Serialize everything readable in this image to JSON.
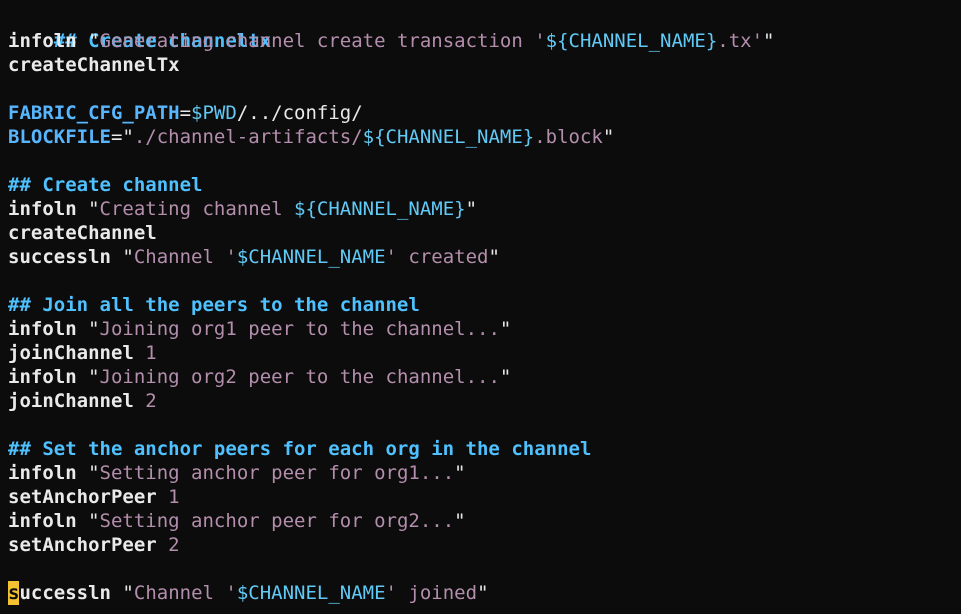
{
  "lines": {
    "l1": {
      "comment": "## Create channeltx"
    },
    "l2": {
      "cmd": "infoln",
      "q1": "\"",
      "text": "Generating channel create transaction '",
      "var": "${CHANNEL_NAME}",
      "text2": ".tx'",
      "q2": "\""
    },
    "l3": {
      "cmd": "createChannelTx"
    },
    "l5": {
      "key": "FABRIC_CFG_PATH",
      "eq": "=",
      "var": "$PWD",
      "rest": "/../config/"
    },
    "l6": {
      "key": "BLOCKFILE",
      "eq": "=",
      "q1": "\"",
      "text": "./channel-artifacts/",
      "var": "${CHANNEL_NAME}",
      "text2": ".block",
      "q2": "\""
    },
    "l8": {
      "comment": "## Create channel"
    },
    "l9": {
      "cmd": "infoln",
      "q1": "\"",
      "text": "Creating channel ",
      "var": "${CHANNEL_NAME}",
      "q2": "\""
    },
    "l10": {
      "cmd": "createChannel"
    },
    "l11": {
      "cmd": "successln",
      "q1": "\"",
      "text": "Channel '",
      "var": "$CHANNEL_NAME",
      "text2": "' created",
      "q2": "\""
    },
    "l13": {
      "comment": "## Join all the peers to the channel"
    },
    "l14": {
      "cmd": "infoln",
      "q1": "\"",
      "text": "Joining org1 peer to the channel...",
      "q2": "\""
    },
    "l15": {
      "cmd": "joinChannel",
      "arg": "1"
    },
    "l16": {
      "cmd": "infoln",
      "q1": "\"",
      "text": "Joining org2 peer to the channel...",
      "q2": "\""
    },
    "l17": {
      "cmd": "joinChannel",
      "arg": "2"
    },
    "l19": {
      "comment": "## Set the anchor peers for each org in the channel"
    },
    "l20": {
      "cmd": "infoln",
      "q1": "\"",
      "text": "Setting anchor peer for org1...",
      "q2": "\""
    },
    "l21": {
      "cmd": "setAnchorPeer",
      "arg": "1"
    },
    "l22": {
      "cmd": "infoln",
      "q1": "\"",
      "text": "Setting anchor peer for org2...",
      "q2": "\""
    },
    "l23": {
      "cmd": "setAnchorPeer",
      "arg": "2"
    },
    "l25": {
      "cursor_char": "s",
      "cmd_rest": "uccessln",
      "q1": "\"",
      "text": "Channel '",
      "var": "$CHANNEL_NAME",
      "text2": "' joined",
      "q2": "\""
    }
  },
  "colors": {
    "background": "#0c0c0c",
    "comment": "#4fc1ff",
    "string": "#b48ead",
    "variable": "#61c9f5",
    "cursor": "#f2c230"
  }
}
